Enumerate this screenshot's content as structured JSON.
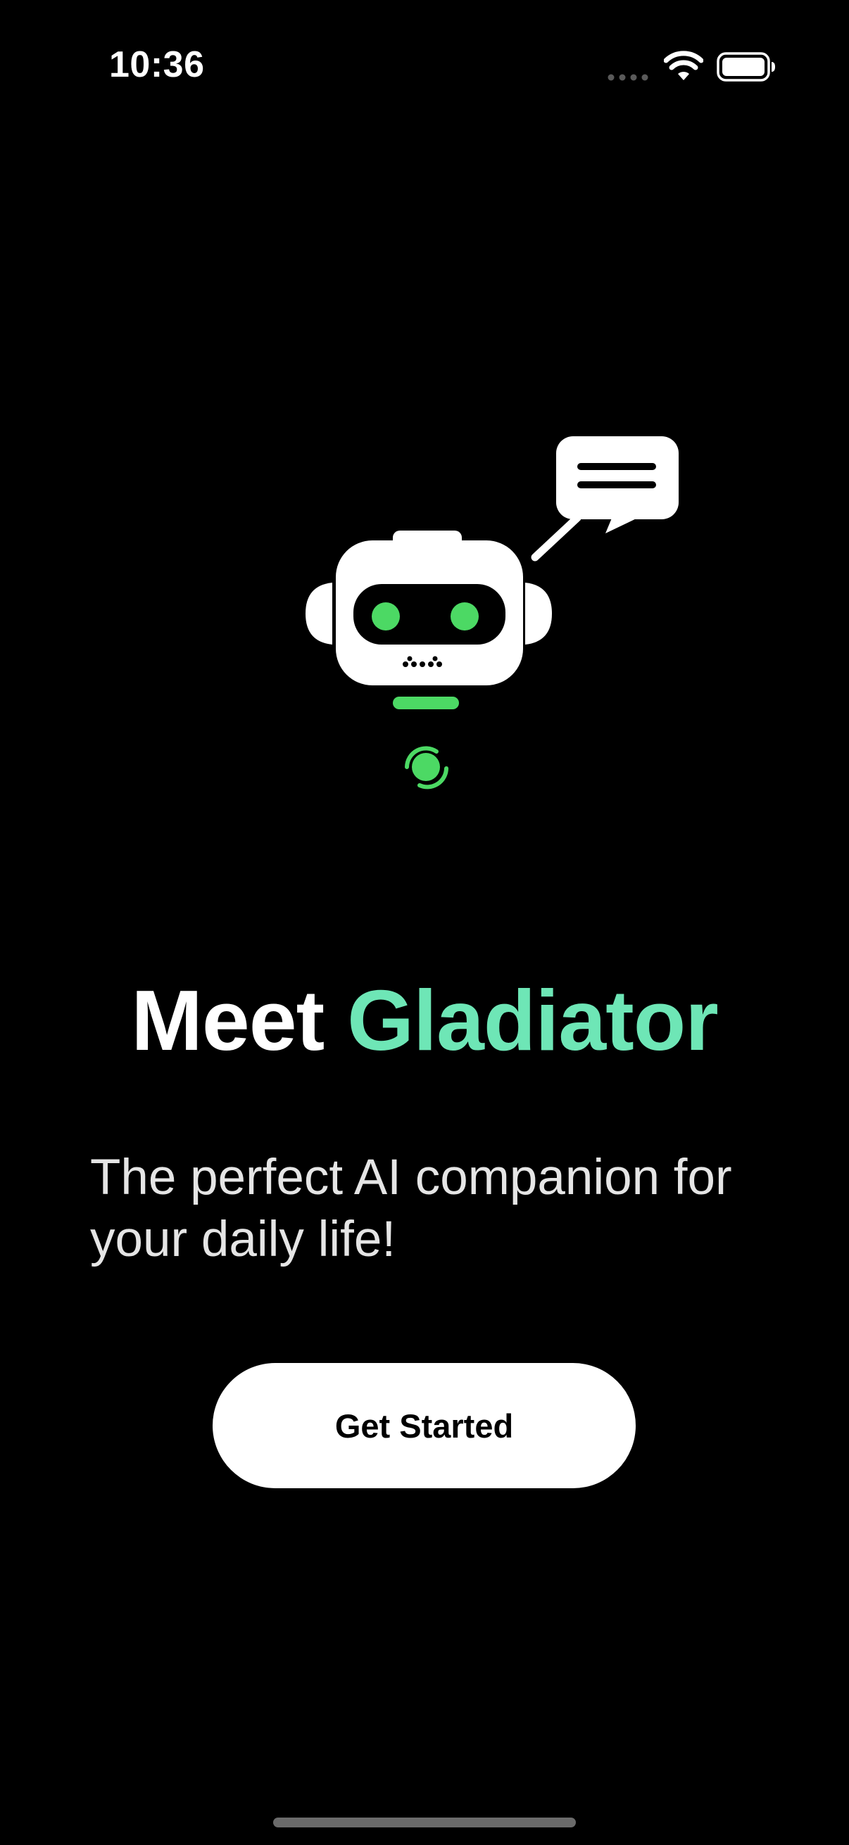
{
  "status_bar": {
    "time": "10:36",
    "icons": [
      "cellular-dots-icon",
      "wifi-icon",
      "battery-icon"
    ]
  },
  "hero": {
    "illustration": "robot-chat-icon",
    "robot_eye_color": "#4cd964",
    "accent_color": "#6ee6b6"
  },
  "headline": {
    "prefix": "Meet ",
    "brand": "Gladiator"
  },
  "subtitle": "The perfect AI companion for your daily life!",
  "cta": {
    "label": "Get Started"
  }
}
